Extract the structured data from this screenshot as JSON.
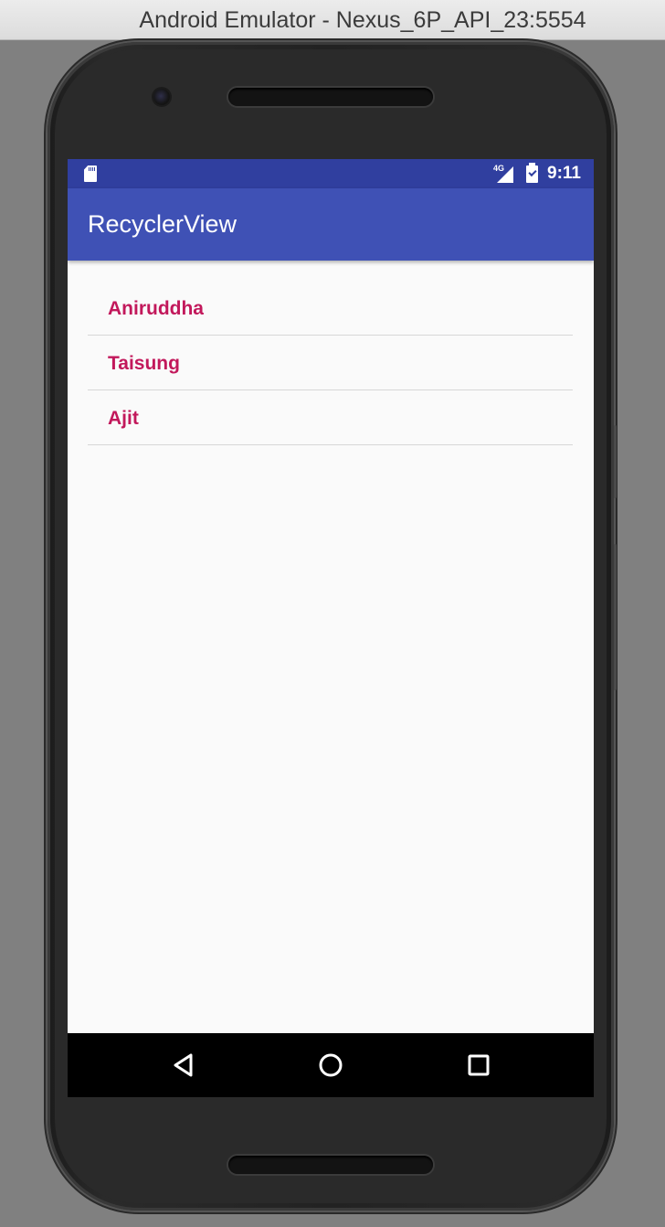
{
  "window": {
    "title": "Android Emulator - Nexus_6P_API_23:5554"
  },
  "status_bar": {
    "network_label": "4G",
    "time": "9:11",
    "icons": [
      "sd-card-icon",
      "signal-icon",
      "battery-charging-icon"
    ]
  },
  "app_bar": {
    "title": "RecyclerView"
  },
  "list": {
    "items": [
      {
        "label": "Aniruddha"
      },
      {
        "label": "Taisung"
      },
      {
        "label": "Ajit"
      }
    ]
  },
  "nav_bar": {
    "icons": [
      "back-icon",
      "home-icon",
      "recents-icon"
    ]
  },
  "colors": {
    "status_bar": "#303f9f",
    "app_bar": "#3f51b5",
    "item_text": "#c2185b",
    "screen_bg": "#fafafa"
  }
}
